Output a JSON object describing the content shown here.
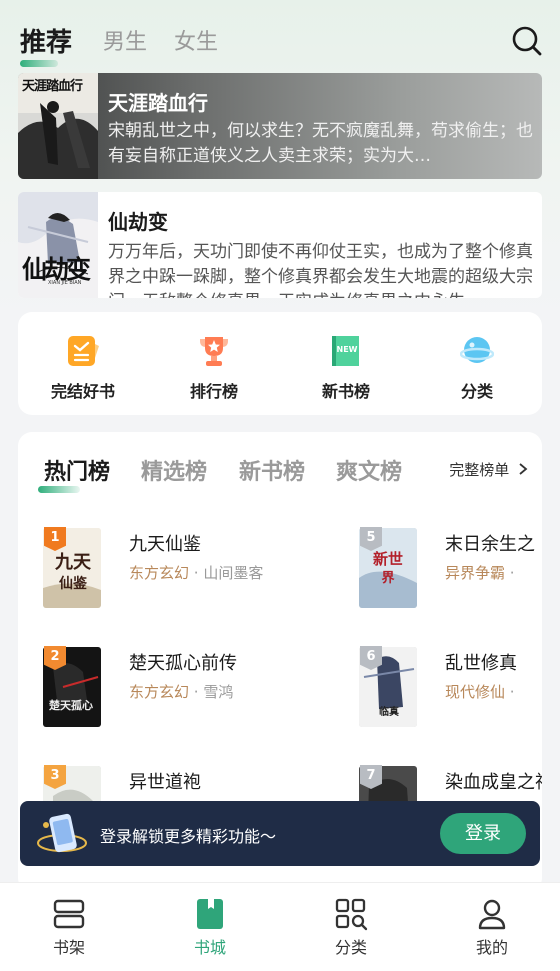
{
  "top_tabs": [
    {
      "label": "推荐",
      "active": true
    },
    {
      "label": "男生",
      "active": false
    },
    {
      "label": "女生",
      "active": false
    }
  ],
  "featured": [
    {
      "title": "天涯踏血行",
      "desc": "宋朝乱世之中，何以求生？无不疯魔乱舞，苟求偷生；也有妄自称正道侠义之人卖主求荣；实为大…",
      "cover_text": "天涯踏血行"
    },
    {
      "title": "仙劫变",
      "desc": "万万年后，天功门即使不再仰仗王实，也成为了整个修真界之中跺一跺脚，整个修真界都会发生大地震的超级大宗门，无敌整个修真界，王实成为修真界之中永生…",
      "cover_text": "仙劫变",
      "cover_sub": "XIAN JIE BIAN"
    }
  ],
  "quick_entries": [
    {
      "label": "完结好书",
      "icon": "finished-book-icon"
    },
    {
      "label": "排行榜",
      "icon": "trophy-icon"
    },
    {
      "label": "新书榜",
      "icon": "new-book-icon"
    },
    {
      "label": "分类",
      "icon": "category-planet-icon"
    }
  ],
  "rank": {
    "tabs": [
      {
        "label": "热门榜",
        "active": true
      },
      {
        "label": "精选榜",
        "active": false
      },
      {
        "label": "新书榜",
        "active": false
      },
      {
        "label": "爽文榜",
        "active": false
      }
    ],
    "more_label": "完整榜单",
    "more_icon": "chevron-right-icon",
    "items": [
      {
        "rank": "1",
        "title": "九天仙鉴",
        "genre": "东方玄幻",
        "author": "山间墨客",
        "cover_text": "九天仙鉴"
      },
      {
        "rank": "2",
        "title": "楚天孤心前传",
        "genre": "东方玄幻",
        "author": "雪鸿",
        "cover_text": "楚天孤心"
      },
      {
        "rank": "3",
        "title": "异世道袍",
        "genre": "",
        "author": "",
        "cover_text": ""
      },
      {
        "rank": "5",
        "title": "末日余生之",
        "genre": "异界争霸",
        "author": "",
        "cover_text": "新世界"
      },
      {
        "rank": "6",
        "title": "乱世修真",
        "genre": "现代修仙",
        "author": "",
        "cover_text": "临真"
      },
      {
        "rank": "7",
        "title": "染血成皇之神",
        "genre": "",
        "author": "",
        "cover_text": ""
      }
    ]
  },
  "login_banner": {
    "text": "登录解锁更多精彩功能～",
    "button": "登录"
  },
  "bottom_nav": [
    {
      "label": "书架",
      "icon": "bookshelf-icon",
      "active": false
    },
    {
      "label": "书城",
      "icon": "bookstore-icon",
      "active": true
    },
    {
      "label": "分类",
      "icon": "category-grid-icon",
      "active": false
    },
    {
      "label": "我的",
      "icon": "profile-icon",
      "active": false
    }
  ],
  "colors": {
    "accent": "#2fa57a",
    "banner_bg": "#1f2c46",
    "genre": "#b8885a",
    "badge_1": "#f07a1f",
    "badge_2": "#f28a30",
    "badge_3": "#f4a440",
    "badge_other": "#b8bcc2"
  }
}
